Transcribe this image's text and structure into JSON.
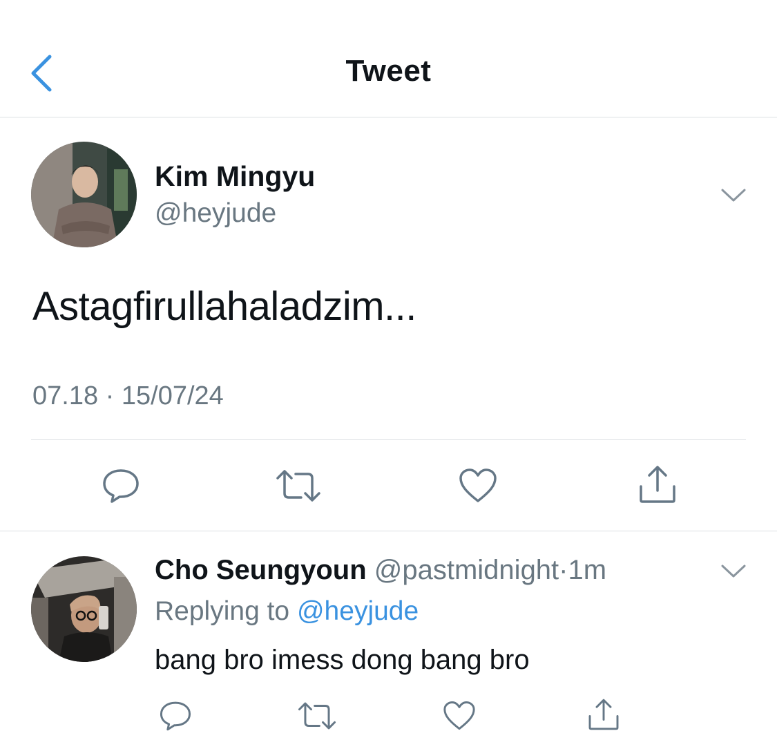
{
  "header": {
    "title": "Tweet",
    "back_icon": "chevron-left-icon"
  },
  "tweet": {
    "display_name": "Kim Mingyu",
    "handle": "@heyjude",
    "text": "Astagfirullahaladzim...",
    "timestamp": "07.18 · 15/07/24",
    "actions": [
      "reply-icon",
      "retweet-icon",
      "like-icon",
      "share-icon"
    ]
  },
  "reply": {
    "display_name": "Cho Seungyoun",
    "handle": "@pastmidnight",
    "separator": "·",
    "time": "1m",
    "replying_prefix": "Replying to",
    "replying_to": "@heyjude",
    "text": "bang bro imess dong bang bro",
    "actions": [
      "reply-icon",
      "retweet-icon",
      "like-icon",
      "share-icon"
    ]
  },
  "colors": {
    "accent": "#3a92e0",
    "secondary_text": "#697781",
    "divider": "#dcdfe3"
  }
}
